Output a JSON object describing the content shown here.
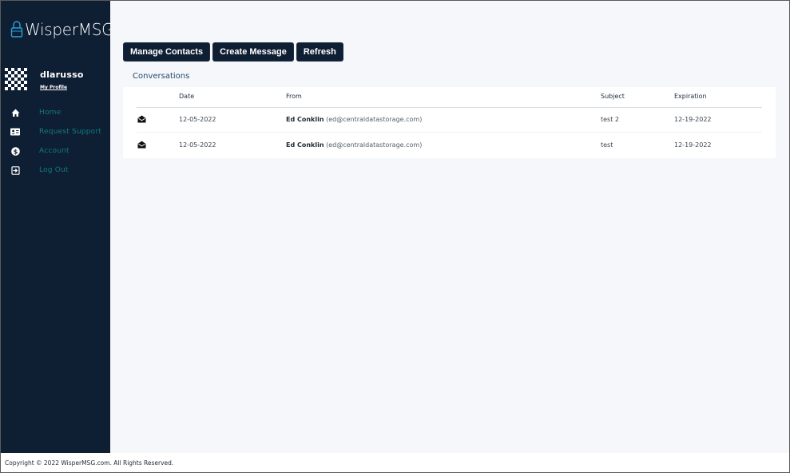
{
  "app": {
    "logo_text": "WisperMSG"
  },
  "user": {
    "username": "dlarusso",
    "profile_link": "My Profile"
  },
  "sidebar": {
    "items": [
      {
        "label": "Home",
        "icon": "home-icon"
      },
      {
        "label": "Request Support",
        "icon": "contact-card-icon"
      },
      {
        "label": "Account",
        "icon": "dollar-coin-icon"
      },
      {
        "label": "Log Out",
        "icon": "logout-icon"
      }
    ]
  },
  "toolbar": {
    "manage_contacts": "Manage Contacts",
    "create_message": "Create Message",
    "refresh": "Refresh"
  },
  "conversations": {
    "title": "Conversations",
    "columns": {
      "date": "Date",
      "from": "From",
      "subject": "Subject",
      "expiration": "Expiration"
    },
    "rows": [
      {
        "icon": "envelope-open-icon",
        "date": "12-05-2022",
        "from_name": "Ed Conklin",
        "from_email": "(ed@centraldatastorage.com)",
        "subject": "test 2",
        "expiration": "12-19-2022"
      },
      {
        "icon": "envelope-open-icon",
        "date": "12-05-2022",
        "from_name": "Ed Conklin",
        "from_email": "(ed@centraldatastorage.com)",
        "subject": "test",
        "expiration": "12-19-2022"
      }
    ]
  },
  "footer": {
    "copyright": "Copyright © 2022 WisperMSG.com. All Rights Reserved."
  },
  "colors": {
    "sidebar_bg": "#0e1e33",
    "nav_text": "#127c7a",
    "main_bg": "#f5f7fa",
    "button_bg": "#0e1e33"
  }
}
